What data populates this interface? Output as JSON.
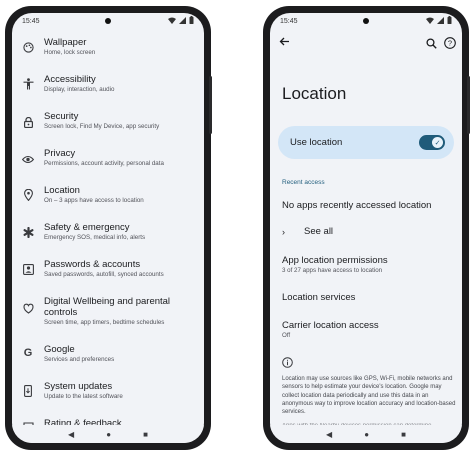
{
  "left_phone": {
    "status_time": "15:45",
    "settings": [
      {
        "title": "Wallpaper",
        "subtitle": "Home, lock screen",
        "icon": "palette-icon"
      },
      {
        "title": "Accessibility",
        "subtitle": "Display, interaction, audio",
        "icon": "accessibility-icon"
      },
      {
        "title": "Security",
        "subtitle": "Screen lock, Find My Device, app security",
        "icon": "lock-icon"
      },
      {
        "title": "Privacy",
        "subtitle": "Permissions, account activity, personal data",
        "icon": "eye-icon"
      },
      {
        "title": "Location",
        "subtitle": "On – 3 apps have access to location",
        "icon": "location-pin-icon"
      },
      {
        "title": "Safety & emergency",
        "subtitle": "Emergency SOS, medical info, alerts",
        "icon": "asterisk-icon"
      },
      {
        "title": "Passwords & accounts",
        "subtitle": "Saved passwords, autofill, synced accounts",
        "icon": "account-box-icon"
      },
      {
        "title": "Digital Wellbeing and parental controls",
        "subtitle": "Screen time, app timers, bedtime schedules",
        "icon": "wellbeing-icon"
      },
      {
        "title": "Google",
        "subtitle": "Services and preferences",
        "icon": "google-icon"
      },
      {
        "title": "System updates",
        "subtitle": "Update to the latest software",
        "icon": "phone-update-icon"
      },
      {
        "title": "Rating & feedback",
        "subtitle": "",
        "icon": "feedback-icon"
      }
    ]
  },
  "right_phone": {
    "status_time": "15:45",
    "title": "Location",
    "use_location": {
      "label": "Use location",
      "enabled": true
    },
    "recent_access_header": "Recent access",
    "no_recent": "No apps recently accessed location",
    "see_all": "See all",
    "app_permissions": {
      "title": "App location permissions",
      "subtitle": "3 of 27 apps have access to location"
    },
    "location_services": "Location services",
    "carrier_access": {
      "title": "Carrier location access",
      "subtitle": "Off"
    },
    "footer": "Location may use sources like GPS, Wi-Fi, mobile networks and sensors to help estimate your device's location. Google may collect location data periodically and use this data in an anonymous way to improve location accuracy and location-based services.",
    "footer_cut": "Apps with the Nearby devices permission can determine"
  },
  "colors": {
    "accent": "#1f5b7a",
    "card": "#d3e6f7",
    "screen_bg": "#f1f3f7"
  }
}
